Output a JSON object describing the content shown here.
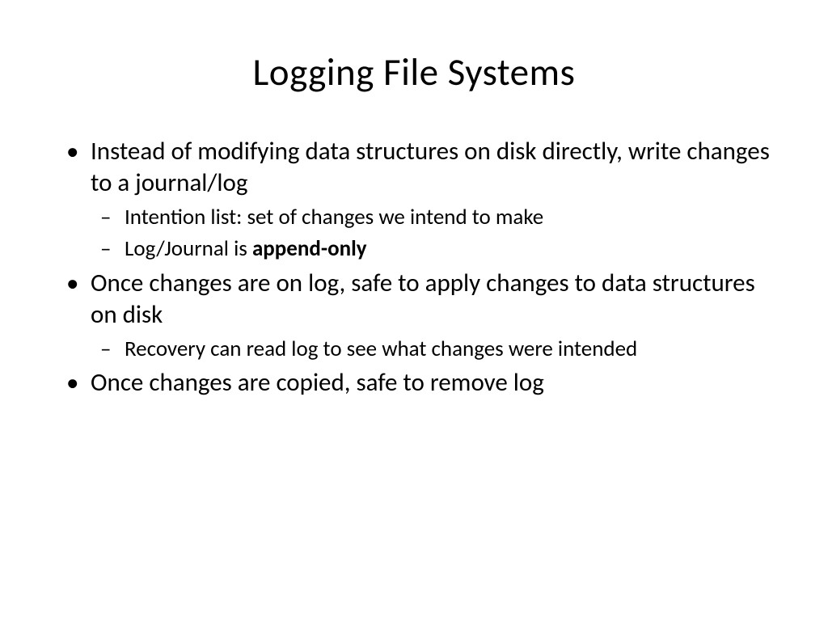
{
  "title": "Logging File Systems",
  "bullets": {
    "b1": "Instead of modifying data structures on disk directly, write changes to a journal/log",
    "b1_sub1": "Intention list: set of changes we intend to make",
    "b1_sub2_prefix": "Log/Journal is ",
    "b1_sub2_bold": "append-only",
    "b2": "Once changes are on log, safe to apply changes to data structures on disk",
    "b2_sub1": "Recovery can read log to see what changes were intended",
    "b3": "Once changes are copied, safe to remove log"
  }
}
